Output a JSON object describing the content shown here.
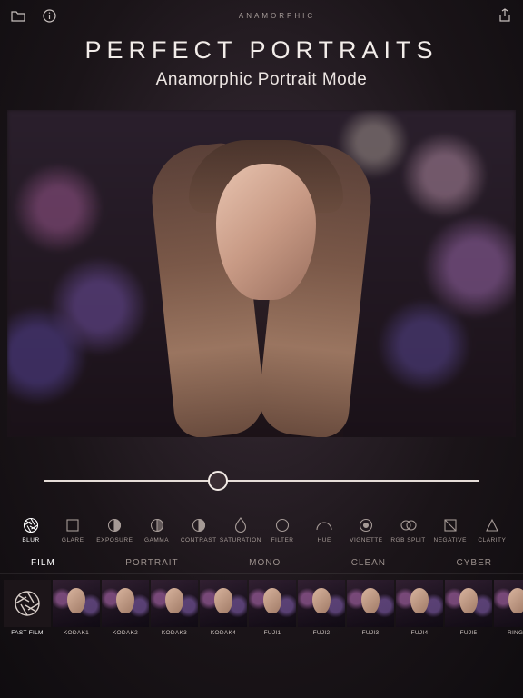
{
  "app_title": "ANAMORPHIC",
  "headline": {
    "title": "PERFECT PORTRAITS",
    "subtitle": "Anamorphic Portrait Mode"
  },
  "slider": {
    "position_percent": 40
  },
  "tools": [
    {
      "id": "blur",
      "label": "BLUR",
      "icon": "aperture",
      "active": true
    },
    {
      "id": "glare",
      "label": "GLARE",
      "icon": "square"
    },
    {
      "id": "exposure",
      "label": "EXPOSURE",
      "icon": "half-circle"
    },
    {
      "id": "gamma",
      "label": "GAMMA",
      "icon": "half-contrast"
    },
    {
      "id": "contrast",
      "label": "CONTRAST",
      "icon": "contrast"
    },
    {
      "id": "saturation",
      "label": "SATURATION",
      "icon": "drop"
    },
    {
      "id": "filter",
      "label": "FILTER",
      "icon": "circle"
    },
    {
      "id": "hue",
      "label": "HUE",
      "icon": "arc"
    },
    {
      "id": "vignette",
      "label": "VIGNETTE",
      "icon": "target"
    },
    {
      "id": "rgb-split",
      "label": "RGB SPLIT",
      "icon": "overlap"
    },
    {
      "id": "negative",
      "label": "NEGATIVE",
      "icon": "neg-square"
    },
    {
      "id": "clarity",
      "label": "CLARITY",
      "icon": "triangle"
    }
  ],
  "tabs": [
    {
      "id": "film",
      "label": "FILM",
      "active": true
    },
    {
      "id": "portrait",
      "label": "PORTRAIT"
    },
    {
      "id": "mono",
      "label": "MONO"
    },
    {
      "id": "clean",
      "label": "CLEAN"
    },
    {
      "id": "cyber",
      "label": "CYBER"
    }
  ],
  "presets": [
    {
      "id": "fast-film",
      "label": "FAST FILM",
      "aperture": true,
      "active": true
    },
    {
      "id": "kodak1",
      "label": "KODAK1"
    },
    {
      "id": "kodak2",
      "label": "KODAK2"
    },
    {
      "id": "kodak3",
      "label": "KODAK3"
    },
    {
      "id": "kodak4",
      "label": "KODAK4"
    },
    {
      "id": "fuji1",
      "label": "FUJI1"
    },
    {
      "id": "fuji2",
      "label": "FUJI2"
    },
    {
      "id": "fuji3",
      "label": "FUJI3"
    },
    {
      "id": "fuji4",
      "label": "FUJI4"
    },
    {
      "id": "fuji5",
      "label": "FUJI5"
    },
    {
      "id": "rings",
      "label": "RINGS"
    }
  ]
}
